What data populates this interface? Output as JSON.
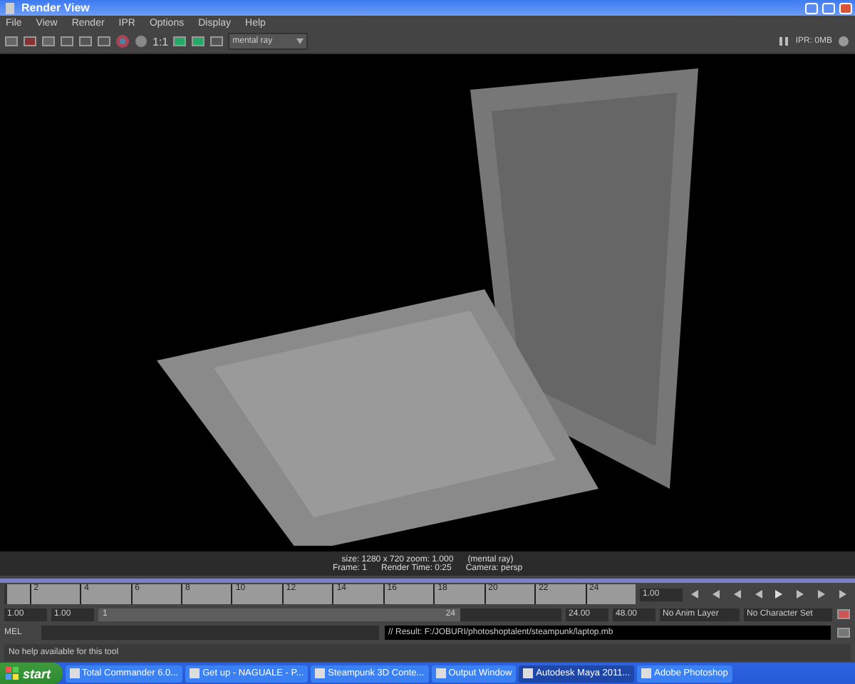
{
  "window": {
    "title": "Render View"
  },
  "menu": [
    "File",
    "View",
    "Render",
    "IPR",
    "Options",
    "Display",
    "Help"
  ],
  "toolbar": {
    "scale_label": "1:1",
    "renderer": "mental ray",
    "ipr_status": "IPR: 0MB"
  },
  "render_info": [
    [
      "size: 1280 x 720 zoom: 1.000",
      "(mental ray)"
    ],
    [
      "Frame: 1",
      "Render Time: 0:25",
      "Camera: persp"
    ]
  ],
  "timeline": {
    "ticks": [
      "2",
      "4",
      "6",
      "8",
      "10",
      "12",
      "14",
      "16",
      "18",
      "20",
      "22",
      "24"
    ],
    "level": 0,
    "current_frame": "1.00"
  },
  "range": {
    "start": "1.00",
    "playback_start": "1.00",
    "slider_start": "1",
    "slider_end": "24",
    "level": 0.78,
    "playback_end": "24.00",
    "end": "48.00",
    "anim_layer": "No Anim Layer",
    "character_set": "No Character Set"
  },
  "command_line": {
    "label": "MEL",
    "result": "// Result: F:/JOBURI/photoshoptalent/steampunk/laptop.mb"
  },
  "help_line": "No help available for this tool",
  "taskbar": {
    "start": "start",
    "tasks": [
      {
        "label": "Total Commander 6.0...",
        "selected": false
      },
      {
        "label": "Get up - NAGUALE - P...",
        "selected": false
      },
      {
        "label": "Steampunk 3D Conte...",
        "selected": false
      },
      {
        "label": "Output Window",
        "selected": false
      },
      {
        "label": "Autodesk Maya 2011...",
        "selected": true
      },
      {
        "label": "Adobe Photoshop",
        "selected": false
      }
    ]
  }
}
